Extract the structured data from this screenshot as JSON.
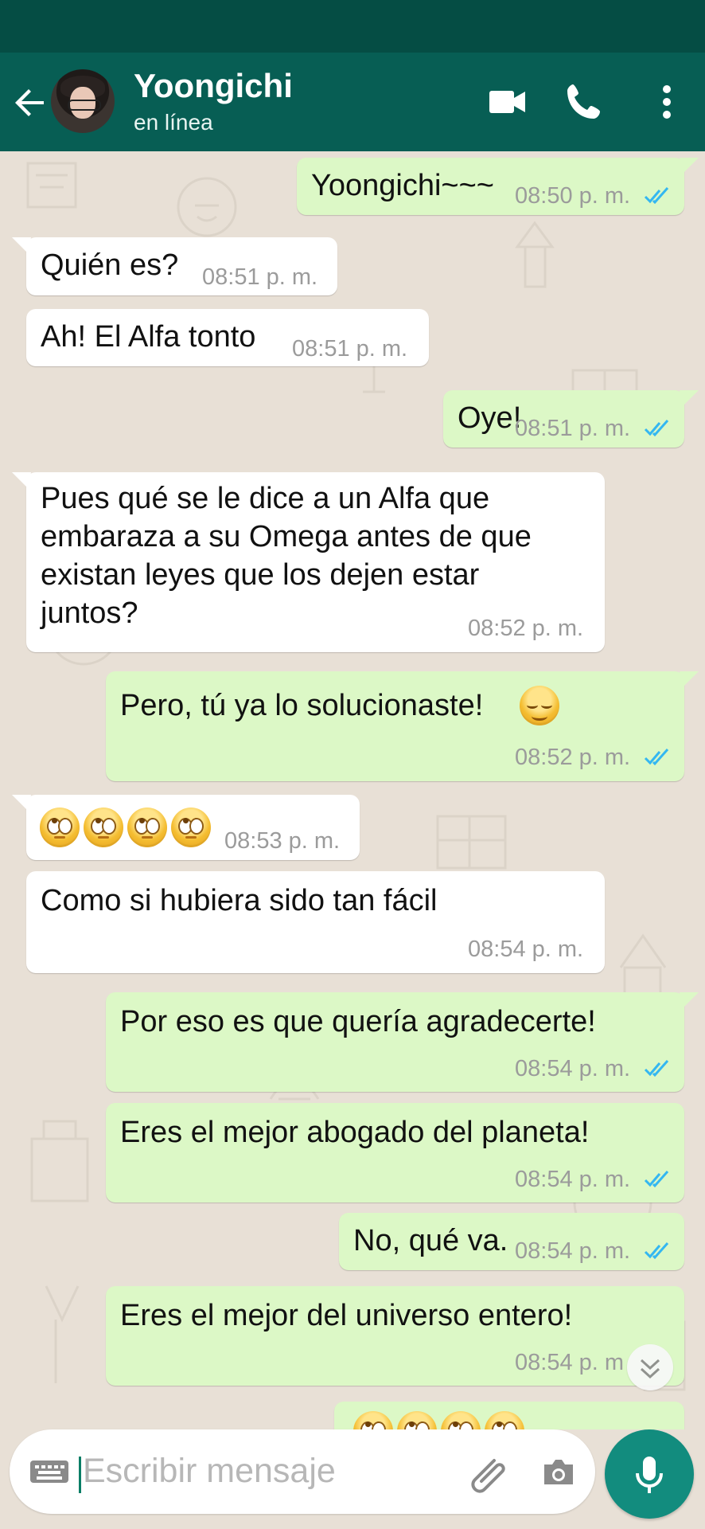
{
  "header": {
    "contact_name": "Yoongichi",
    "contact_status": "en línea",
    "actions": [
      "video-call",
      "voice-call",
      "more-options"
    ]
  },
  "messages": [
    {
      "direction": "out",
      "text": "Yoongichi~~~",
      "time": "08:50 p. m.",
      "read": true
    },
    {
      "direction": "in",
      "text": "Quién es?",
      "time": "08:51 p. m."
    },
    {
      "direction": "in",
      "text": "Ah! El Alfa tonto",
      "time": "08:51 p. m."
    },
    {
      "direction": "out",
      "text": "Oye!",
      "time": "08:51 p. m.",
      "read": true
    },
    {
      "direction": "in",
      "text_lines": [
        "Pues qué se le dice a un Alfa que",
        "embaraza a su Omega antes de que",
        "existan leyes que los dejen estar",
        "juntos?"
      ],
      "time": "08:52 p. m."
    },
    {
      "direction": "out",
      "text": "Pero, tú ya lo solucionaste!",
      "emoji": "relieved",
      "time": "08:52 p. m.",
      "read": true
    },
    {
      "direction": "in",
      "emojis": [
        "face-with-rolling-eyes",
        "face-with-rolling-eyes",
        "face-with-rolling-eyes",
        "face-with-rolling-eyes"
      ],
      "time": "08:53 p. m."
    },
    {
      "direction": "in",
      "text": "Como si hubiera sido tan fácil",
      "time": "08:54 p. m."
    },
    {
      "direction": "out",
      "text": "Por eso es que quería agradecerte!",
      "time": "08:54 p. m.",
      "read": true
    },
    {
      "direction": "out",
      "text": "Eres el mejor abogado del planeta!",
      "time": "08:54 p. m.",
      "read": true
    },
    {
      "direction": "out",
      "text": "No, qué va.",
      "time": "08:54 p. m.",
      "read": true
    },
    {
      "direction": "out",
      "text": "Eres el mejor del universo entero!",
      "time": "08:54 p. m",
      "read": true
    }
  ],
  "input": {
    "placeholder": "Escribir mensaje"
  },
  "colors": {
    "header": "#075e54",
    "status_bar": "#054d44",
    "outgoing_bubble": "#dcf8c6",
    "incoming_bubble": "#ffffff",
    "chat_background": "#e8e0d6",
    "read_ticks": "#34b7f1",
    "mic_button": "#128c7e"
  }
}
